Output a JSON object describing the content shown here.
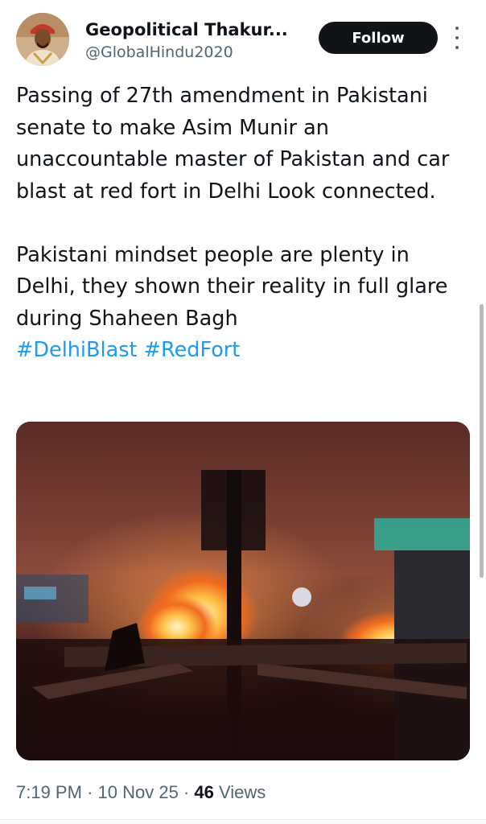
{
  "author": {
    "display_name": "Geopolitical Thakur...",
    "handle": "@GlobalHindu2020"
  },
  "header": {
    "follow_label": "Follow",
    "more_icon": "more-vertical-icon"
  },
  "tweet": {
    "paragraph1": "Passing of 27th amendment in Pakistani senate to make Asim Munir an unaccountable master of Pakistan and car blast at red fort in Delhi Look connected.",
    "paragraph2": "Pakistani mindset people are plenty in Delhi, they shown their reality in full glare during Shaheen Bagh",
    "hashtags": [
      "#DelhiBlast",
      "#RedFort"
    ]
  },
  "meta": {
    "time": "7:19 PM",
    "sep1": "·",
    "date": "10 Nov 25",
    "sep2": "·",
    "views_count": "46",
    "views_label": "Views"
  },
  "colors": {
    "link": "#1d9bf0",
    "text": "#0f1419",
    "secondary": "#536471",
    "button": "#0f1419"
  }
}
